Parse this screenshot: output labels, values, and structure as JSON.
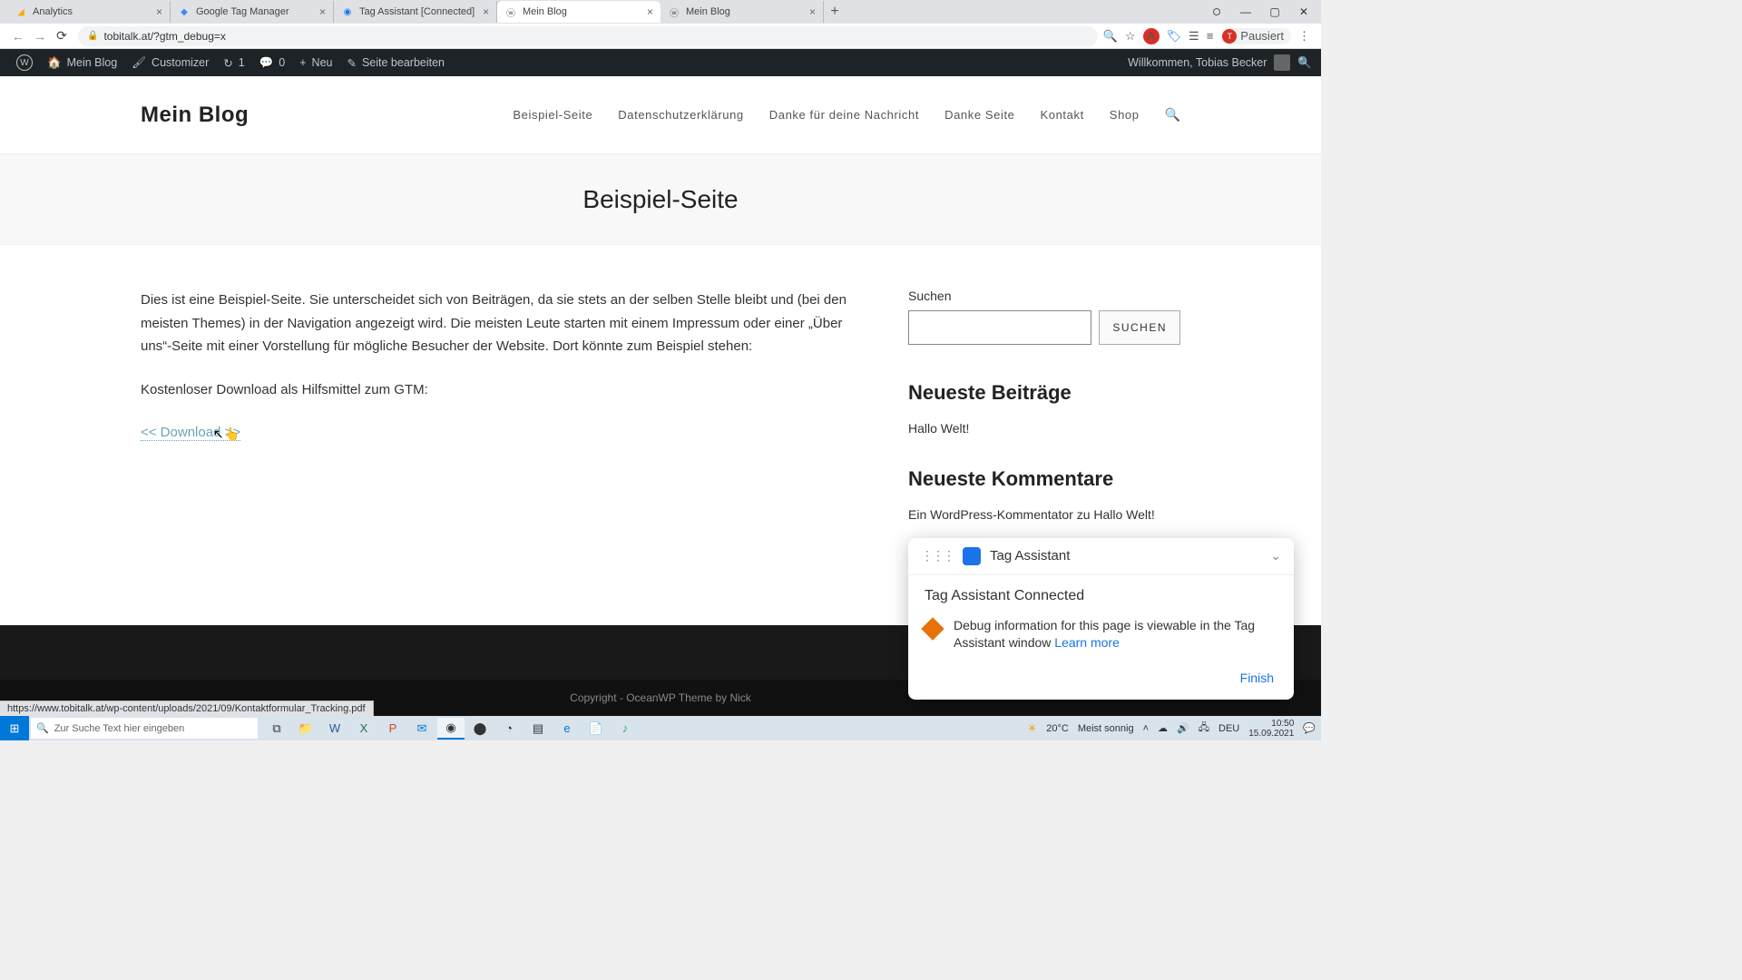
{
  "browser": {
    "tabs": [
      {
        "title": "Analytics",
        "icon": "analytics"
      },
      {
        "title": "Google Tag Manager",
        "icon": "gtm"
      },
      {
        "title": "Tag Assistant [Connected]",
        "icon": "tagassist"
      },
      {
        "title": "Mein Blog",
        "icon": "wp",
        "active": true
      },
      {
        "title": "Mein Blog",
        "icon": "wp"
      }
    ],
    "url": "tobitalk.at/?gtm_debug=x",
    "pause_label": "Pausiert",
    "pause_initial": "T"
  },
  "wpbar": {
    "site": "Mein Blog",
    "customizer": "Customizer",
    "updates": "1",
    "comments": "0",
    "new": "Neu",
    "edit": "Seite bearbeiten",
    "welcome": "Willkommen, Tobias Becker"
  },
  "site": {
    "title": "Mein Blog",
    "nav": [
      "Beispiel-Seite",
      "Datenschutzerklärung",
      "Danke für deine Nachricht",
      "Danke Seite",
      "Kontakt",
      "Shop"
    ],
    "page_title": "Beispiel-Seite"
  },
  "content": {
    "p1": "Dies ist eine Beispiel-Seite. Sie unterscheidet sich von Beiträgen, da sie stets an der selben Stelle bleibt und (bei den meisten Themes) in der Navigation angezeigt wird. Die meisten Leute starten mit einem Impressum oder einer „Über uns“-Seite mit einer Vorstellung für mögliche Besucher der Website. Dort könnte zum Beispiel stehen:",
    "p2": "Kostenloser Download als Hilfsmittel zum GTM:",
    "download": "<< Download >>"
  },
  "sidebar": {
    "search_label": "Suchen",
    "search_btn": "SUCHEN",
    "recent_posts_h": "Neueste Beiträge",
    "recent_post_1": "Hallo Welt!",
    "recent_comments_h": "Neueste Kommentare",
    "recent_comment_1": "Ein WordPress-Kommentator zu Hallo Welt!"
  },
  "footer": {
    "copyright": "Copyright - OceanWP Theme by Nick"
  },
  "tag_assistant": {
    "title": "Tag Assistant",
    "connected": "Tag Assistant Connected",
    "message": "Debug information for this page is viewable in the Tag Assistant window ",
    "learn_more": "Learn more",
    "finish": "Finish"
  },
  "status_url": "https://www.tobitalk.at/wp-content/uploads/2021/09/Kontaktformular_Tracking.pdf",
  "taskbar": {
    "search_placeholder": "Zur Suche Text hier eingeben",
    "weather_temp": "20°C",
    "weather_text": "Meist sonnig",
    "lang": "DEU",
    "time": "10:50",
    "date": "15.09.2021"
  }
}
